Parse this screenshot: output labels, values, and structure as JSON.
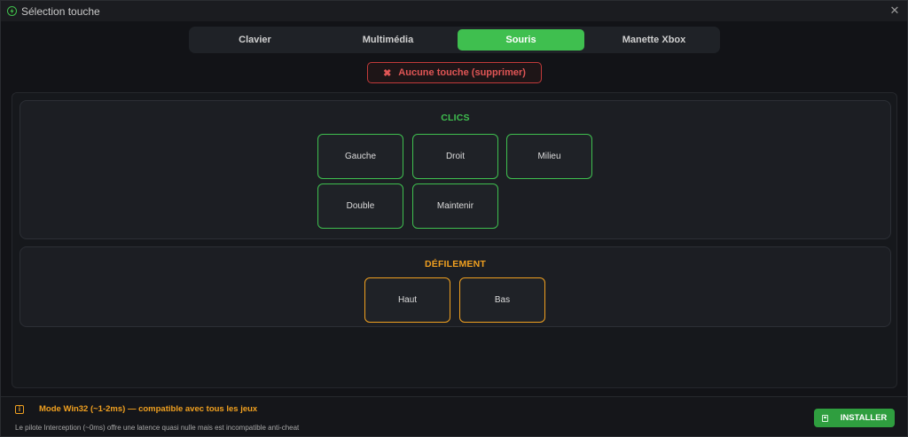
{
  "window": {
    "title": "Sélection touche",
    "close_glyph": "✕"
  },
  "tabs": [
    {
      "label": "Clavier",
      "active": false
    },
    {
      "label": "Multimédia",
      "active": false
    },
    {
      "label": "Souris",
      "active": true
    },
    {
      "label": "Manette Xbox",
      "active": false
    }
  ],
  "none_button": {
    "icon": "✖",
    "label": "Aucune touche (supprimer)"
  },
  "groups": {
    "clics": {
      "title": "CLICS",
      "keys": [
        "Gauche",
        "Droit",
        "Milieu",
        "Double",
        "Maintenir"
      ]
    },
    "scroll": {
      "title": "DÉFILEMENT",
      "keys": [
        "Haut",
        "Bas"
      ]
    }
  },
  "footer": {
    "info_glyph": "i",
    "mode_text": "Mode Win32 (~1-2ms) — compatible avec tous les jeux",
    "sub_text": "Le pilote Interception (~0ms) offre une latence quasi nulle mais est incompatible anti-cheat",
    "install_label": "INSTALLER"
  },
  "colors": {
    "accent_green": "#3fbf4f",
    "accent_orange": "#f0a020",
    "danger_red": "#e05555",
    "background": "#121317"
  }
}
